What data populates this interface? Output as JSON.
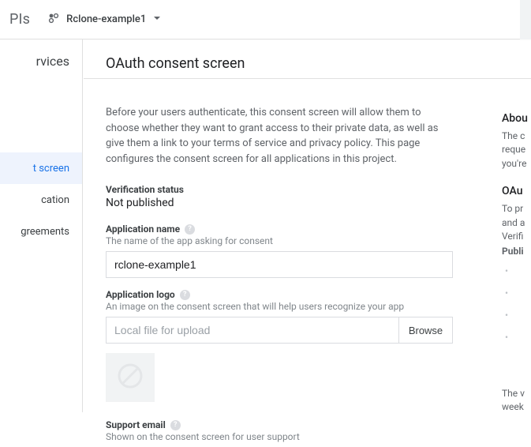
{
  "topbar": {
    "title_fragment": "PIs",
    "project_name": "Rclone-example1"
  },
  "sidebar": {
    "heading_fragment": "rvices",
    "items": [
      {
        "label_fragment": "t screen",
        "active": true
      },
      {
        "label_fragment": "cation",
        "active": false
      },
      {
        "label_fragment": "greements",
        "active": false
      }
    ]
  },
  "page": {
    "title": "OAuth consent screen",
    "intro": "Before your users authenticate, this consent screen will allow them to choose whether they want to grant access to their private data, as well as give them a link to your terms of service and privacy policy. This page configures the consent screen for all applications in this project."
  },
  "verification": {
    "label": "Verification status",
    "value": "Not published"
  },
  "app_name": {
    "label": "Application name",
    "hint": "The name of the app asking for consent",
    "value": "rclone-example1"
  },
  "app_logo": {
    "label": "Application logo",
    "hint": "An image on the consent screen that will help users recognize your app",
    "placeholder": "Local file for upload",
    "browse": "Browse"
  },
  "support_email": {
    "label": "Support email",
    "hint": "Shown on the consent screen for user support"
  },
  "right": {
    "about_heading_fragment": "Abou",
    "about_body_fragment": "The c\nreque\nyou're",
    "oauth_heading_fragment": "OAu",
    "oauth_body_fragment": "To pr\nand a\nVerifi",
    "oauth_bold_fragment": "Publi",
    "footer_fragment1": "The v",
    "footer_fragment2": "week"
  }
}
